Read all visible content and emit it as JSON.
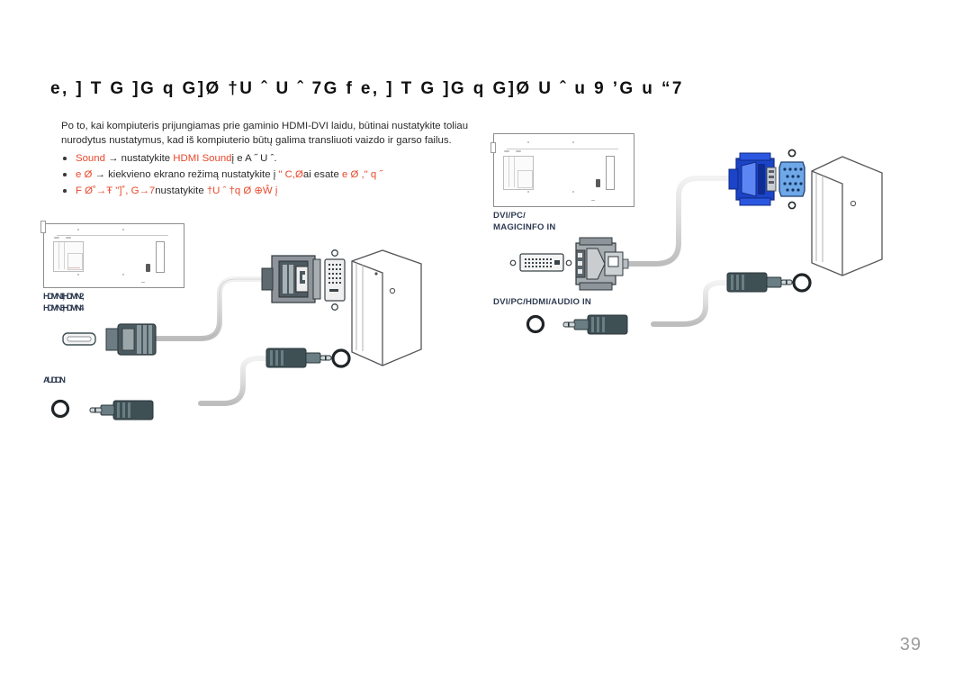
{
  "document": {
    "title": "e,  ]  T G  ]G  q  G]Ø †U ˆ U ˆ 7G  f e,  ]  T G  ]G  q  G]Ø U ˆ u 9 ’G u “7",
    "page_number": "39"
  },
  "intro": {
    "text": "Po to, kai kompiuteris prijungiamas prie gaminio HDMI-DVI laidu, būtinai nustatykite toliau nurodytus nustatymus, kad iš kompiuterio būtų galima transliuoti vaizdo ir garso failus."
  },
  "bullets": [
    {
      "segments": [
        {
          "text": "Sound",
          "color": "accent"
        },
        {
          "text": " → ",
          "color": "dark"
        },
        {
          "text": "nustatykite ",
          "color": "dark"
        },
        {
          "text": "HDMI Sound",
          "color": "accent"
        },
        {
          "text": "į e A ˝ U  ˆ.",
          "color": "dark"
        }
      ]
    },
    {
      "segments": [
        {
          "text": "e    Ø",
          "color": "accent"
        },
        {
          "text": " → ",
          "color": "dark"
        },
        {
          "text": "kiekvieno ekrano režimą nustatykite į ",
          "color": "dark"
        },
        {
          "text": "\" C,Ø",
          "color": "accent"
        },
        {
          "text": "ai esate ",
          "color": "dark"
        },
        {
          "text": "e    Ø  ,\"    q  ˝",
          "color": "accent"
        }
      ]
    },
    {
      "segments": [
        {
          "text": "F  Ø˚→Ŧ  \"]˚, G→7",
          "color": "accent"
        },
        {
          "text": "nustatykite ",
          "color": "dark"
        },
        {
          "text": "†U ˆ †q Ø  ⊕Ŵ    į",
          "color": "accent"
        }
      ]
    }
  ],
  "diagrams": {
    "left": {
      "name": "hdmi-dvi-connection-diagram",
      "port_label_top": "HDMI IN 1, HDMI IN 2,\nHDMI IN 3, HDMI IN 4",
      "port_label_top_line1": "HDMI IN 1, HDMI IN 2,",
      "port_label_top_line2": "HDMI IN 3, HDMI IN 4",
      "port_label_bottom": "AUDIO IN",
      "connectors": [
        "hdmi-port",
        "hdmi-plug",
        "dvi-plug",
        "dvi-port",
        "audio-jack",
        "audio-port"
      ]
    },
    "right": {
      "name": "dvi-pc-vga-connection-diagram",
      "port_label_top_line1": "DVI/PC/",
      "port_label_top_line2": "MAGICINFO IN",
      "port_label_bottom": "DVI/PC/HDMI/AUDIO IN",
      "connectors": [
        "dvi-port",
        "dvi-plug",
        "vga-plug",
        "vga-port",
        "audio-jack",
        "audio-port"
      ]
    }
  },
  "colors": {
    "accent_red": "#e8482b",
    "label_navy": "#2f3b52",
    "connector_dark": "#3f5055",
    "connector_gray": "#8c9296",
    "vga_blue": "#1b44c8",
    "vga_port_blue": "#6fa8e8",
    "cable_gray": "#d8d8d8",
    "page_number_gray": "#9b9b9b"
  }
}
